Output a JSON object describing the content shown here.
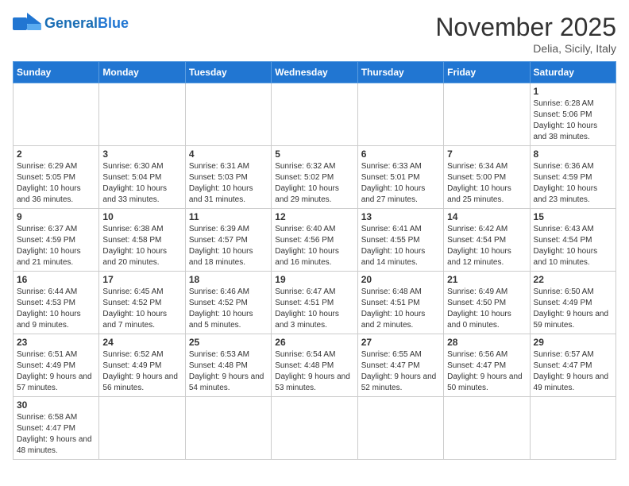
{
  "header": {
    "logo_general": "General",
    "logo_blue": "Blue",
    "month_title": "November 2025",
    "subtitle": "Delia, Sicily, Italy"
  },
  "days_of_week": [
    "Sunday",
    "Monday",
    "Tuesday",
    "Wednesday",
    "Thursday",
    "Friday",
    "Saturday"
  ],
  "weeks": [
    [
      {
        "day": "",
        "info": ""
      },
      {
        "day": "",
        "info": ""
      },
      {
        "day": "",
        "info": ""
      },
      {
        "day": "",
        "info": ""
      },
      {
        "day": "",
        "info": ""
      },
      {
        "day": "",
        "info": ""
      },
      {
        "day": "1",
        "info": "Sunrise: 6:28 AM\nSunset: 5:06 PM\nDaylight: 10 hours and 38 minutes."
      }
    ],
    [
      {
        "day": "2",
        "info": "Sunrise: 6:29 AM\nSunset: 5:05 PM\nDaylight: 10 hours and 36 minutes."
      },
      {
        "day": "3",
        "info": "Sunrise: 6:30 AM\nSunset: 5:04 PM\nDaylight: 10 hours and 33 minutes."
      },
      {
        "day": "4",
        "info": "Sunrise: 6:31 AM\nSunset: 5:03 PM\nDaylight: 10 hours and 31 minutes."
      },
      {
        "day": "5",
        "info": "Sunrise: 6:32 AM\nSunset: 5:02 PM\nDaylight: 10 hours and 29 minutes."
      },
      {
        "day": "6",
        "info": "Sunrise: 6:33 AM\nSunset: 5:01 PM\nDaylight: 10 hours and 27 minutes."
      },
      {
        "day": "7",
        "info": "Sunrise: 6:34 AM\nSunset: 5:00 PM\nDaylight: 10 hours and 25 minutes."
      },
      {
        "day": "8",
        "info": "Sunrise: 6:36 AM\nSunset: 4:59 PM\nDaylight: 10 hours and 23 minutes."
      }
    ],
    [
      {
        "day": "9",
        "info": "Sunrise: 6:37 AM\nSunset: 4:59 PM\nDaylight: 10 hours and 21 minutes."
      },
      {
        "day": "10",
        "info": "Sunrise: 6:38 AM\nSunset: 4:58 PM\nDaylight: 10 hours and 20 minutes."
      },
      {
        "day": "11",
        "info": "Sunrise: 6:39 AM\nSunset: 4:57 PM\nDaylight: 10 hours and 18 minutes."
      },
      {
        "day": "12",
        "info": "Sunrise: 6:40 AM\nSunset: 4:56 PM\nDaylight: 10 hours and 16 minutes."
      },
      {
        "day": "13",
        "info": "Sunrise: 6:41 AM\nSunset: 4:55 PM\nDaylight: 10 hours and 14 minutes."
      },
      {
        "day": "14",
        "info": "Sunrise: 6:42 AM\nSunset: 4:54 PM\nDaylight: 10 hours and 12 minutes."
      },
      {
        "day": "15",
        "info": "Sunrise: 6:43 AM\nSunset: 4:54 PM\nDaylight: 10 hours and 10 minutes."
      }
    ],
    [
      {
        "day": "16",
        "info": "Sunrise: 6:44 AM\nSunset: 4:53 PM\nDaylight: 10 hours and 9 minutes."
      },
      {
        "day": "17",
        "info": "Sunrise: 6:45 AM\nSunset: 4:52 PM\nDaylight: 10 hours and 7 minutes."
      },
      {
        "day": "18",
        "info": "Sunrise: 6:46 AM\nSunset: 4:52 PM\nDaylight: 10 hours and 5 minutes."
      },
      {
        "day": "19",
        "info": "Sunrise: 6:47 AM\nSunset: 4:51 PM\nDaylight: 10 hours and 3 minutes."
      },
      {
        "day": "20",
        "info": "Sunrise: 6:48 AM\nSunset: 4:51 PM\nDaylight: 10 hours and 2 minutes."
      },
      {
        "day": "21",
        "info": "Sunrise: 6:49 AM\nSunset: 4:50 PM\nDaylight: 10 hours and 0 minutes."
      },
      {
        "day": "22",
        "info": "Sunrise: 6:50 AM\nSunset: 4:49 PM\nDaylight: 9 hours and 59 minutes."
      }
    ],
    [
      {
        "day": "23",
        "info": "Sunrise: 6:51 AM\nSunset: 4:49 PM\nDaylight: 9 hours and 57 minutes."
      },
      {
        "day": "24",
        "info": "Sunrise: 6:52 AM\nSunset: 4:49 PM\nDaylight: 9 hours and 56 minutes."
      },
      {
        "day": "25",
        "info": "Sunrise: 6:53 AM\nSunset: 4:48 PM\nDaylight: 9 hours and 54 minutes."
      },
      {
        "day": "26",
        "info": "Sunrise: 6:54 AM\nSunset: 4:48 PM\nDaylight: 9 hours and 53 minutes."
      },
      {
        "day": "27",
        "info": "Sunrise: 6:55 AM\nSunset: 4:47 PM\nDaylight: 9 hours and 52 minutes."
      },
      {
        "day": "28",
        "info": "Sunrise: 6:56 AM\nSunset: 4:47 PM\nDaylight: 9 hours and 50 minutes."
      },
      {
        "day": "29",
        "info": "Sunrise: 6:57 AM\nSunset: 4:47 PM\nDaylight: 9 hours and 49 minutes."
      }
    ],
    [
      {
        "day": "30",
        "info": "Sunrise: 6:58 AM\nSunset: 4:47 PM\nDaylight: 9 hours and 48 minutes."
      },
      {
        "day": "",
        "info": ""
      },
      {
        "day": "",
        "info": ""
      },
      {
        "day": "",
        "info": ""
      },
      {
        "day": "",
        "info": ""
      },
      {
        "day": "",
        "info": ""
      },
      {
        "day": "",
        "info": ""
      }
    ]
  ]
}
